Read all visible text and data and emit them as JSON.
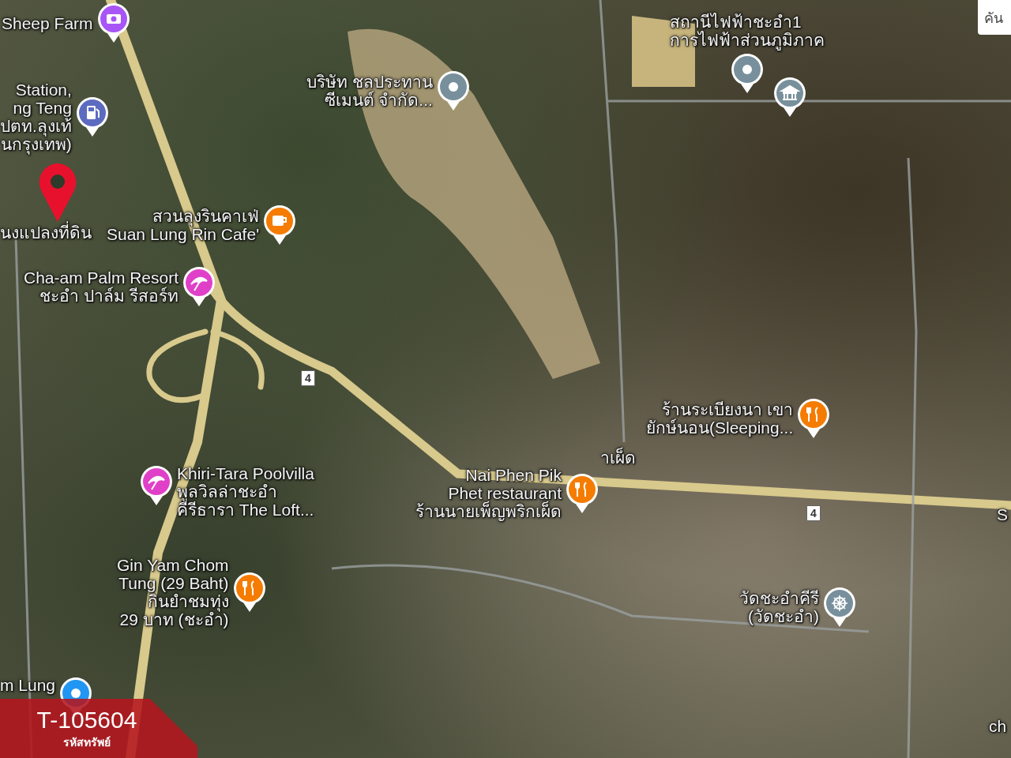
{
  "map": {
    "places": [
      {
        "kind": "camera",
        "lines": [
          "Sheep Farm"
        ]
      },
      {
        "kind": "fuel",
        "lines": [
          "Station,",
          "ng Teng",
          "ปตท.ลุงเท้",
          "นกรุงเทพ)"
        ]
      },
      {
        "kind": "cafe",
        "lines": [
          "สวนลุงรินคาเฟ่",
          "Suan Lung Rin Cafe'"
        ]
      },
      {
        "kind": "resort",
        "lines": [
          "Cha-am Palm Resort",
          "ชะอำ ปาล์ม รีสอร์ท"
        ]
      },
      {
        "kind": "place",
        "lines": [
          "บริษัท ชลประทาน",
          "ซีเมนต์ จำกัด..."
        ]
      },
      {
        "kind": "place",
        "lines": [
          "สถานีไฟฟ้าชะอำ1",
          "การไฟฟ้าส่วนภูมิภาค"
        ]
      },
      {
        "kind": "government"
      },
      {
        "kind": "restaurant",
        "lines": [
          "ร้านระเบียงนา เขา",
          "ยักษ์นอน(Sleeping..."
        ]
      },
      {
        "kind": "resort",
        "lines": [
          "Khiri-Tara Poolvilla",
          "พูลวิลล่าชะอำ",
          "คีรีธารา The Loft..."
        ]
      },
      {
        "kind": "restaurant",
        "lines": [
          "Nai Phen Pik",
          "Phet restaurant",
          "ร้านนายเพ็ญพริกเผ็ด"
        ]
      },
      {
        "kind": "restaurant",
        "lines": [
          "Gin Yam Chom",
          "Tung (29 Baht)",
          "กินยำชมทุ่ง",
          "29 บาท (ชะอำ)"
        ]
      },
      {
        "kind": "temple",
        "lines": [
          "วัดชะอำคีรี",
          "(วัดชะอำ)"
        ]
      },
      {
        "kind": "transit",
        "lines": [
          "m Lung"
        ]
      }
    ],
    "fragments": [
      "าเผ็ด",
      "S",
      "ch"
    ],
    "route_shields": [
      "4",
      "4"
    ],
    "location_pin": {
      "label": "นงแปลงที่ดิน"
    },
    "corner_button": {
      "label": "คัน"
    }
  },
  "listing_code": {
    "code": "T-105604",
    "caption": "รหัสทรัพย์"
  }
}
